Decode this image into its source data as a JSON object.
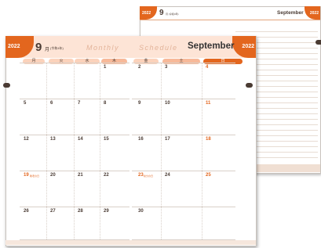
{
  "back": {
    "year": "2022",
    "month_num": "9",
    "month_sub": "月 (令和4年)",
    "month_en": "September",
    "year_right": "2022"
  },
  "front": {
    "year_left": "2022",
    "year_right": "2022",
    "month_num": "9",
    "month_kanji": "月",
    "reiwa": "(令和4年)",
    "monthly": "Monthly",
    "schedule": "Schedule",
    "month_en": "September",
    "weekdays_left": [
      "月",
      "火",
      "水",
      "木"
    ],
    "weekdays_right": [
      "金",
      "土",
      "日"
    ],
    "weeks": [
      [
        "",
        "",
        "",
        "1",
        "2",
        "3",
        "4"
      ],
      [
        "5",
        "6",
        "7",
        "8",
        "9",
        "10",
        "11"
      ],
      [
        "12",
        "13",
        "14",
        "15",
        "16",
        "17",
        "18"
      ],
      [
        "19",
        "20",
        "21",
        "22",
        "23",
        "24",
        "25"
      ],
      [
        "26",
        "27",
        "28",
        "29",
        "30",
        "",
        ""
      ]
    ],
    "holiday_19": "敬老の日",
    "holiday_23": "秋分の日"
  },
  "colors": {
    "accent": "#e3661e",
    "header_bg": "#fde4d6",
    "text": "#4a3b33"
  }
}
